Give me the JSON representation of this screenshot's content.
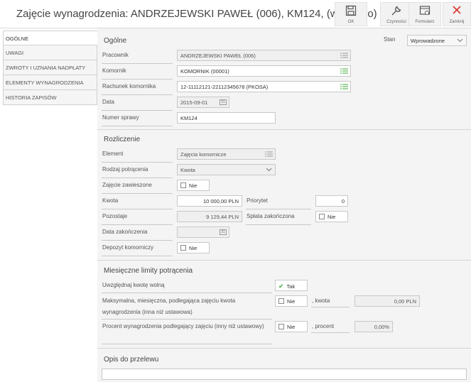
{
  "title": "Zajęcie wynagrodzenia: ANDRZEJEWSKI PAWEŁ (006), KM124, (wszystko)",
  "toolbar": {
    "ok": "OK",
    "czynnosci": "Czynności",
    "formularz": "Formularz",
    "zamknij": "Zamknij"
  },
  "sidebar": {
    "items": [
      {
        "label": "OGÓLNE"
      },
      {
        "label": "UWAGI"
      },
      {
        "label": "ZWROTY I UZNANIA NADPŁATY"
      },
      {
        "label": "ELEMENTY WYNAGRODZENIA"
      },
      {
        "label": "HISTORIA ZAPISÓW"
      }
    ]
  },
  "ogolne": {
    "title": "Ogólne",
    "stan_label": "Stan",
    "stan_value": "Wprowadzone",
    "pracownik_label": "Pracownik",
    "pracownik_value": "ANDRZEJEWSKI PAWEŁ (006)",
    "komornik_label": "Komornik",
    "komornik_value": "KOMORNIK (00001)",
    "rachunek_label": "Rachunek komornika",
    "rachunek_value": "12-11112121-22112345678 (PKOSA)",
    "data_label": "Data",
    "data_value": "2015-09-01",
    "numer_label": "Numer sprawy",
    "numer_value": "KM124"
  },
  "rozliczenie": {
    "title": "Rozliczenie",
    "element_label": "Element",
    "element_value": "Zajęcia komornicze",
    "rodzaj_label": "Rodzaj potrącenia",
    "rodzaj_value": "Kwota",
    "zawieszone_label": "Zajęcie zawieszone",
    "zawieszone_value": "Nie",
    "kwota_label": "Kwota",
    "kwota_value": "10 000,00 PLN",
    "priorytet_label": "Priorytet",
    "priorytet_value": "0",
    "pozostaje_label": "Pozostaje",
    "pozostaje_value": "9 129,44 PLN",
    "splata_label": "Spłata zakończona",
    "splata_value": "Nie",
    "data_zak_label": "Data zakończenia",
    "depozyt_label": "Depozyt komorniczy",
    "depozyt_value": "Nie"
  },
  "limity": {
    "title": "Miesięczne limity potrącenia",
    "kwota_wolna_label": "Uwzględnaj kwotę wolną",
    "kwota_wolna_value": "Tak",
    "max_label_1": "Maksymalna, miesięczna, podlegająca zajęciu kwota",
    "max_label_2": "wynagrodzenia (inna niż ustawowa)",
    "max_value": "Nie",
    "max_kwota_label": ", kwota",
    "max_kwota_value": "0,00 PLN",
    "procent_label": "Procent wynagrodzenia podlegający zajęciu (inny niż ustawowy)",
    "procent_value": "Nie",
    "procent_sub_label": ", procent",
    "procent_sub_value": "0,00%"
  },
  "opis": {
    "title": "Opis do przelewu",
    "value": ""
  },
  "colors": {
    "accent_green": "#3aaa35",
    "close_red": "#d9342b"
  }
}
